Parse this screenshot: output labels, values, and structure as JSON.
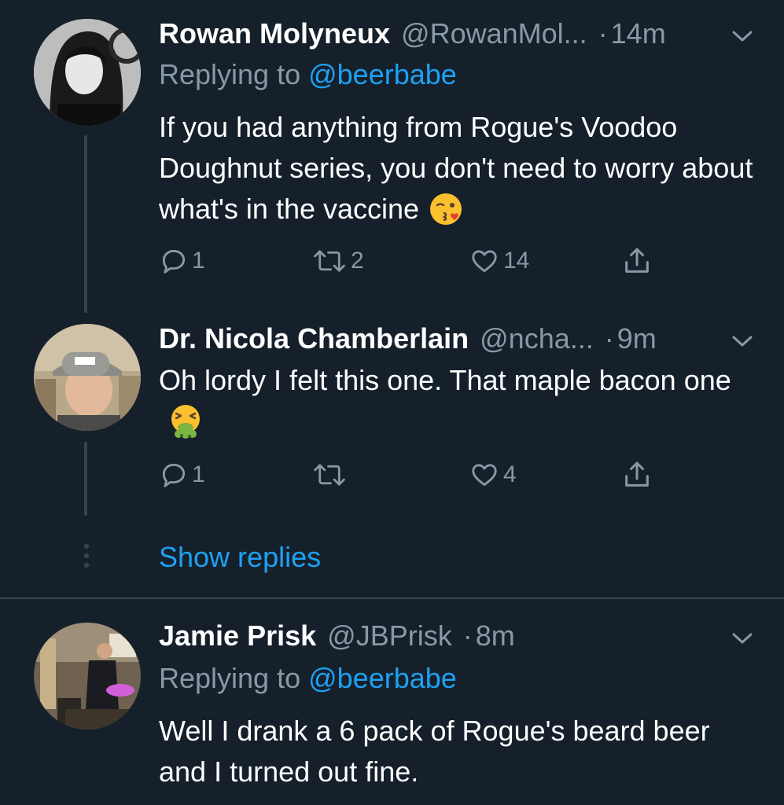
{
  "tweets": [
    {
      "name": "Rowan Molyneux",
      "handle": "@RowanMol...",
      "dot": "·",
      "time": "14m",
      "replying_prefix": "Replying to ",
      "replying_to": "@beerbabe",
      "text": "If you had anything from Rogue's Voodoo Doughnut series, you don't need to worry about what's in the vaccine",
      "emoji": "face-blowing-kiss-emoji",
      "reply_count": "1",
      "retweet_count": "2",
      "like_count": "14"
    },
    {
      "name": "Dr. Nicola Chamberlain",
      "handle": "@ncha...",
      "dot": "·",
      "time": "9m",
      "text": "Oh lordy I felt this one. That maple bacon one",
      "emoji": "vomiting-face-emoji",
      "reply_count": "1",
      "retweet_count": "",
      "like_count": "4"
    },
    {
      "name": "Jamie Prisk",
      "handle": "@JBPrisk",
      "dot": "·",
      "time": "8m",
      "replying_prefix": "Replying to ",
      "replying_to": "@beerbabe",
      "text": "Well I drank a 6 pack of Rogue's beard beer and I turned out fine."
    }
  ],
  "show_replies": "Show replies",
  "icons": {
    "reply": "reply-icon",
    "retweet": "retweet-icon",
    "like": "heart-icon",
    "share": "share-icon",
    "menu": "chevron-down-icon",
    "more": "vertical-dots-icon"
  },
  "colors": {
    "background": "#15202b",
    "primary_text": "#ffffff",
    "secondary_text": "#8899a6",
    "accent": "#1da1f2",
    "line": "#38444d"
  }
}
